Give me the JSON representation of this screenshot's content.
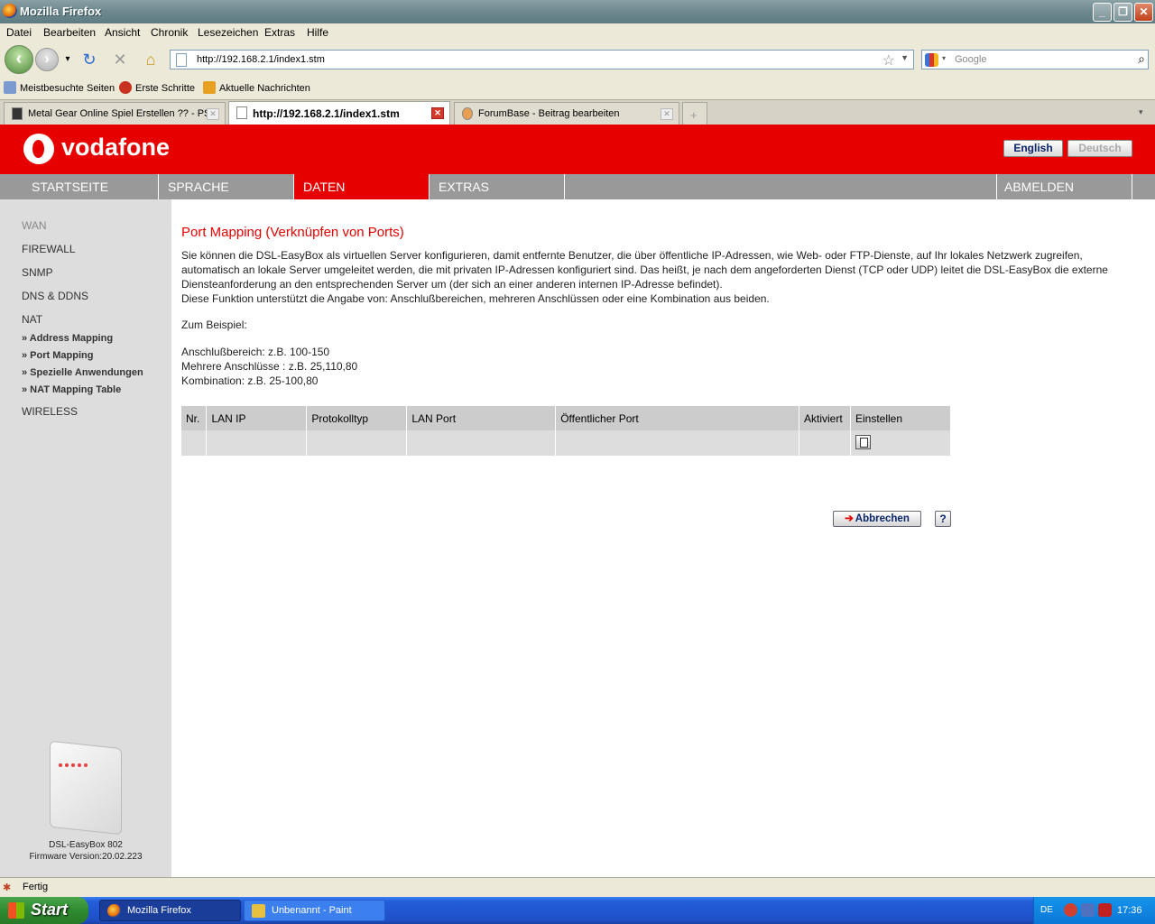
{
  "window": {
    "title": "Mozilla Firefox"
  },
  "menu": [
    "Datei",
    "Bearbeiten",
    "Ansicht",
    "Chronik",
    "Lesezeichen",
    "Extras",
    "Hilfe"
  ],
  "url": "http://192.168.2.1/index1.stm",
  "search": {
    "placeholder": "Google"
  },
  "bookmarks": [
    "Meistbesuchte Seiten",
    "Erste Schritte",
    "Aktuelle Nachrichten"
  ],
  "tabs": [
    {
      "label": "Metal Gear Online Spiel Erstellen ?? - PS..."
    },
    {
      "label": "http://192.168.2.1/index1.stm"
    },
    {
      "label": "ForumBase - Beitrag bearbeiten"
    }
  ],
  "brand": {
    "name": "vodafone",
    "color": "#e60000"
  },
  "lang": {
    "english": "English",
    "deutsch": "Deutsch"
  },
  "mainnav": [
    "STARTSEITE",
    "SPRACHE",
    "DATEN",
    "EXTRAS",
    "ABMELDEN"
  ],
  "sidebar": {
    "items": [
      "WAN",
      "FIREWALL",
      "SNMP",
      "DNS & DDNS",
      "NAT"
    ],
    "nat_sub": [
      "» Address Mapping",
      "» Port Mapping",
      "» Spezielle Anwendungen",
      "» NAT Mapping Table"
    ],
    "wireless": "WIRELESS",
    "device_name": "DSL-EasyBox 802",
    "firmware": "Firmware Version:20.02.223"
  },
  "page": {
    "title": "Port Mapping (Verknüpfen von Ports)",
    "desc1": "Sie können die DSL-EasyBox als virtuellen Server konfigurieren, damit entfernte Benutzer, die über öffentliche IP-Adressen, wie Web- oder FTP-Dienste, auf Ihr lokales Netzwerk zugreifen, automatisch an lokale Server umgeleitet werden, die mit privaten IP-Adressen konfiguriert sind. Das heißt, je nach dem angeforderten Dienst (TCP oder UDP) leitet die DSL-EasyBox die externe Diensteanforderung an den entsprechenden Server um (der sich an einer anderen internen IP-Adresse befindet).",
    "desc2": "Diese Funktion unterstützt die Angabe von: Anschlußbereichen, mehreren Anschlüssen oder eine Kombination aus beiden.",
    "example": "Zum Beispiel:",
    "ex1": "Anschlußbereich: z.B. 100-150",
    "ex2": "Mehrere Anschlüsse : z.B. 25,110,80",
    "ex3": "Kombination: z.B. 25-100,80",
    "table_headers": [
      "Nr.",
      "LAN IP",
      "Protokolltyp",
      "LAN Port",
      "Öffentlicher Port",
      "Aktiviert",
      "Einstellen"
    ],
    "cancel": "Abbrechen",
    "help": "?"
  },
  "status": "Fertig",
  "taskbar": {
    "start": "Start",
    "tasks": [
      "Mozilla Firefox",
      "Unbenannt - Paint"
    ],
    "lang": "DE",
    "clock": "17:36"
  }
}
